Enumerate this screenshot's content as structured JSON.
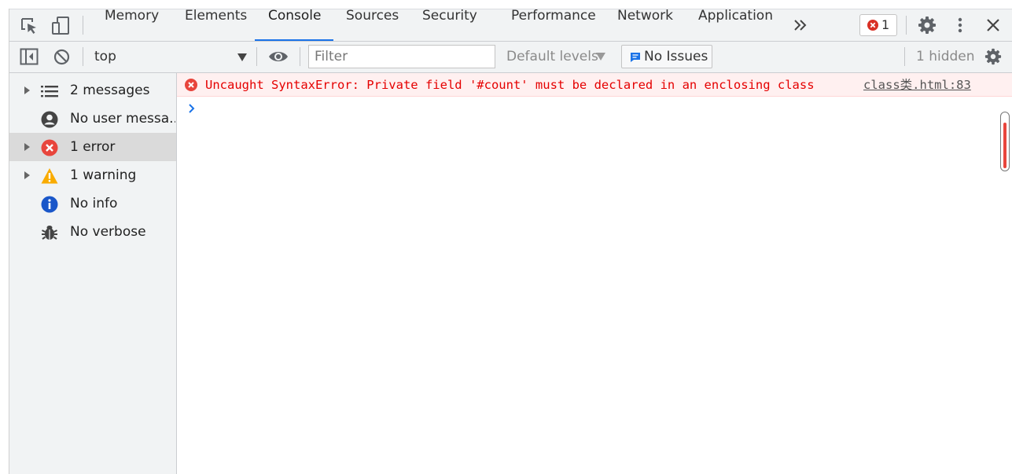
{
  "tabs": {
    "items": [
      {
        "label": "Memory"
      },
      {
        "label": "Elements"
      },
      {
        "label": "Console"
      },
      {
        "label": "Sources"
      },
      {
        "label": "Security"
      },
      {
        "label": "Performance"
      },
      {
        "label": "Network"
      },
      {
        "label": "Application"
      }
    ],
    "active": "Console",
    "overflow_icon": "double-chevron-right-icon",
    "error_count": "1"
  },
  "toolbar": {
    "context_selector": "top",
    "filter_placeholder": "Filter",
    "levels_label": "Default levels",
    "issues_label": "No Issues",
    "hidden_count_label": "1 hidden"
  },
  "sidebar": {
    "items": [
      {
        "label": "2 messages",
        "icon": "list-icon",
        "expandable": true
      },
      {
        "label": "No user messa...",
        "icon": "user-icon",
        "expandable": false
      },
      {
        "label": "1 error",
        "icon": "error-icon",
        "expandable": true,
        "selected": true
      },
      {
        "label": "1 warning",
        "icon": "warning-icon",
        "expandable": true
      },
      {
        "label": "No info",
        "icon": "info-icon",
        "expandable": false
      },
      {
        "label": "No verbose",
        "icon": "bug-icon",
        "expandable": false
      }
    ]
  },
  "console": {
    "error_message": "Uncaught SyntaxError: Private field '#count' must be declared in an enclosing class",
    "error_source": "class类.html:83",
    "prompt_icon": "chevron-right-icon"
  },
  "colors": {
    "accent": "#1a73e8",
    "error": "#e50000",
    "error_bg": "#fff0f0",
    "warning": "#f9ab00",
    "info": "#1a73e8",
    "panel_bg": "#f1f3f4"
  }
}
